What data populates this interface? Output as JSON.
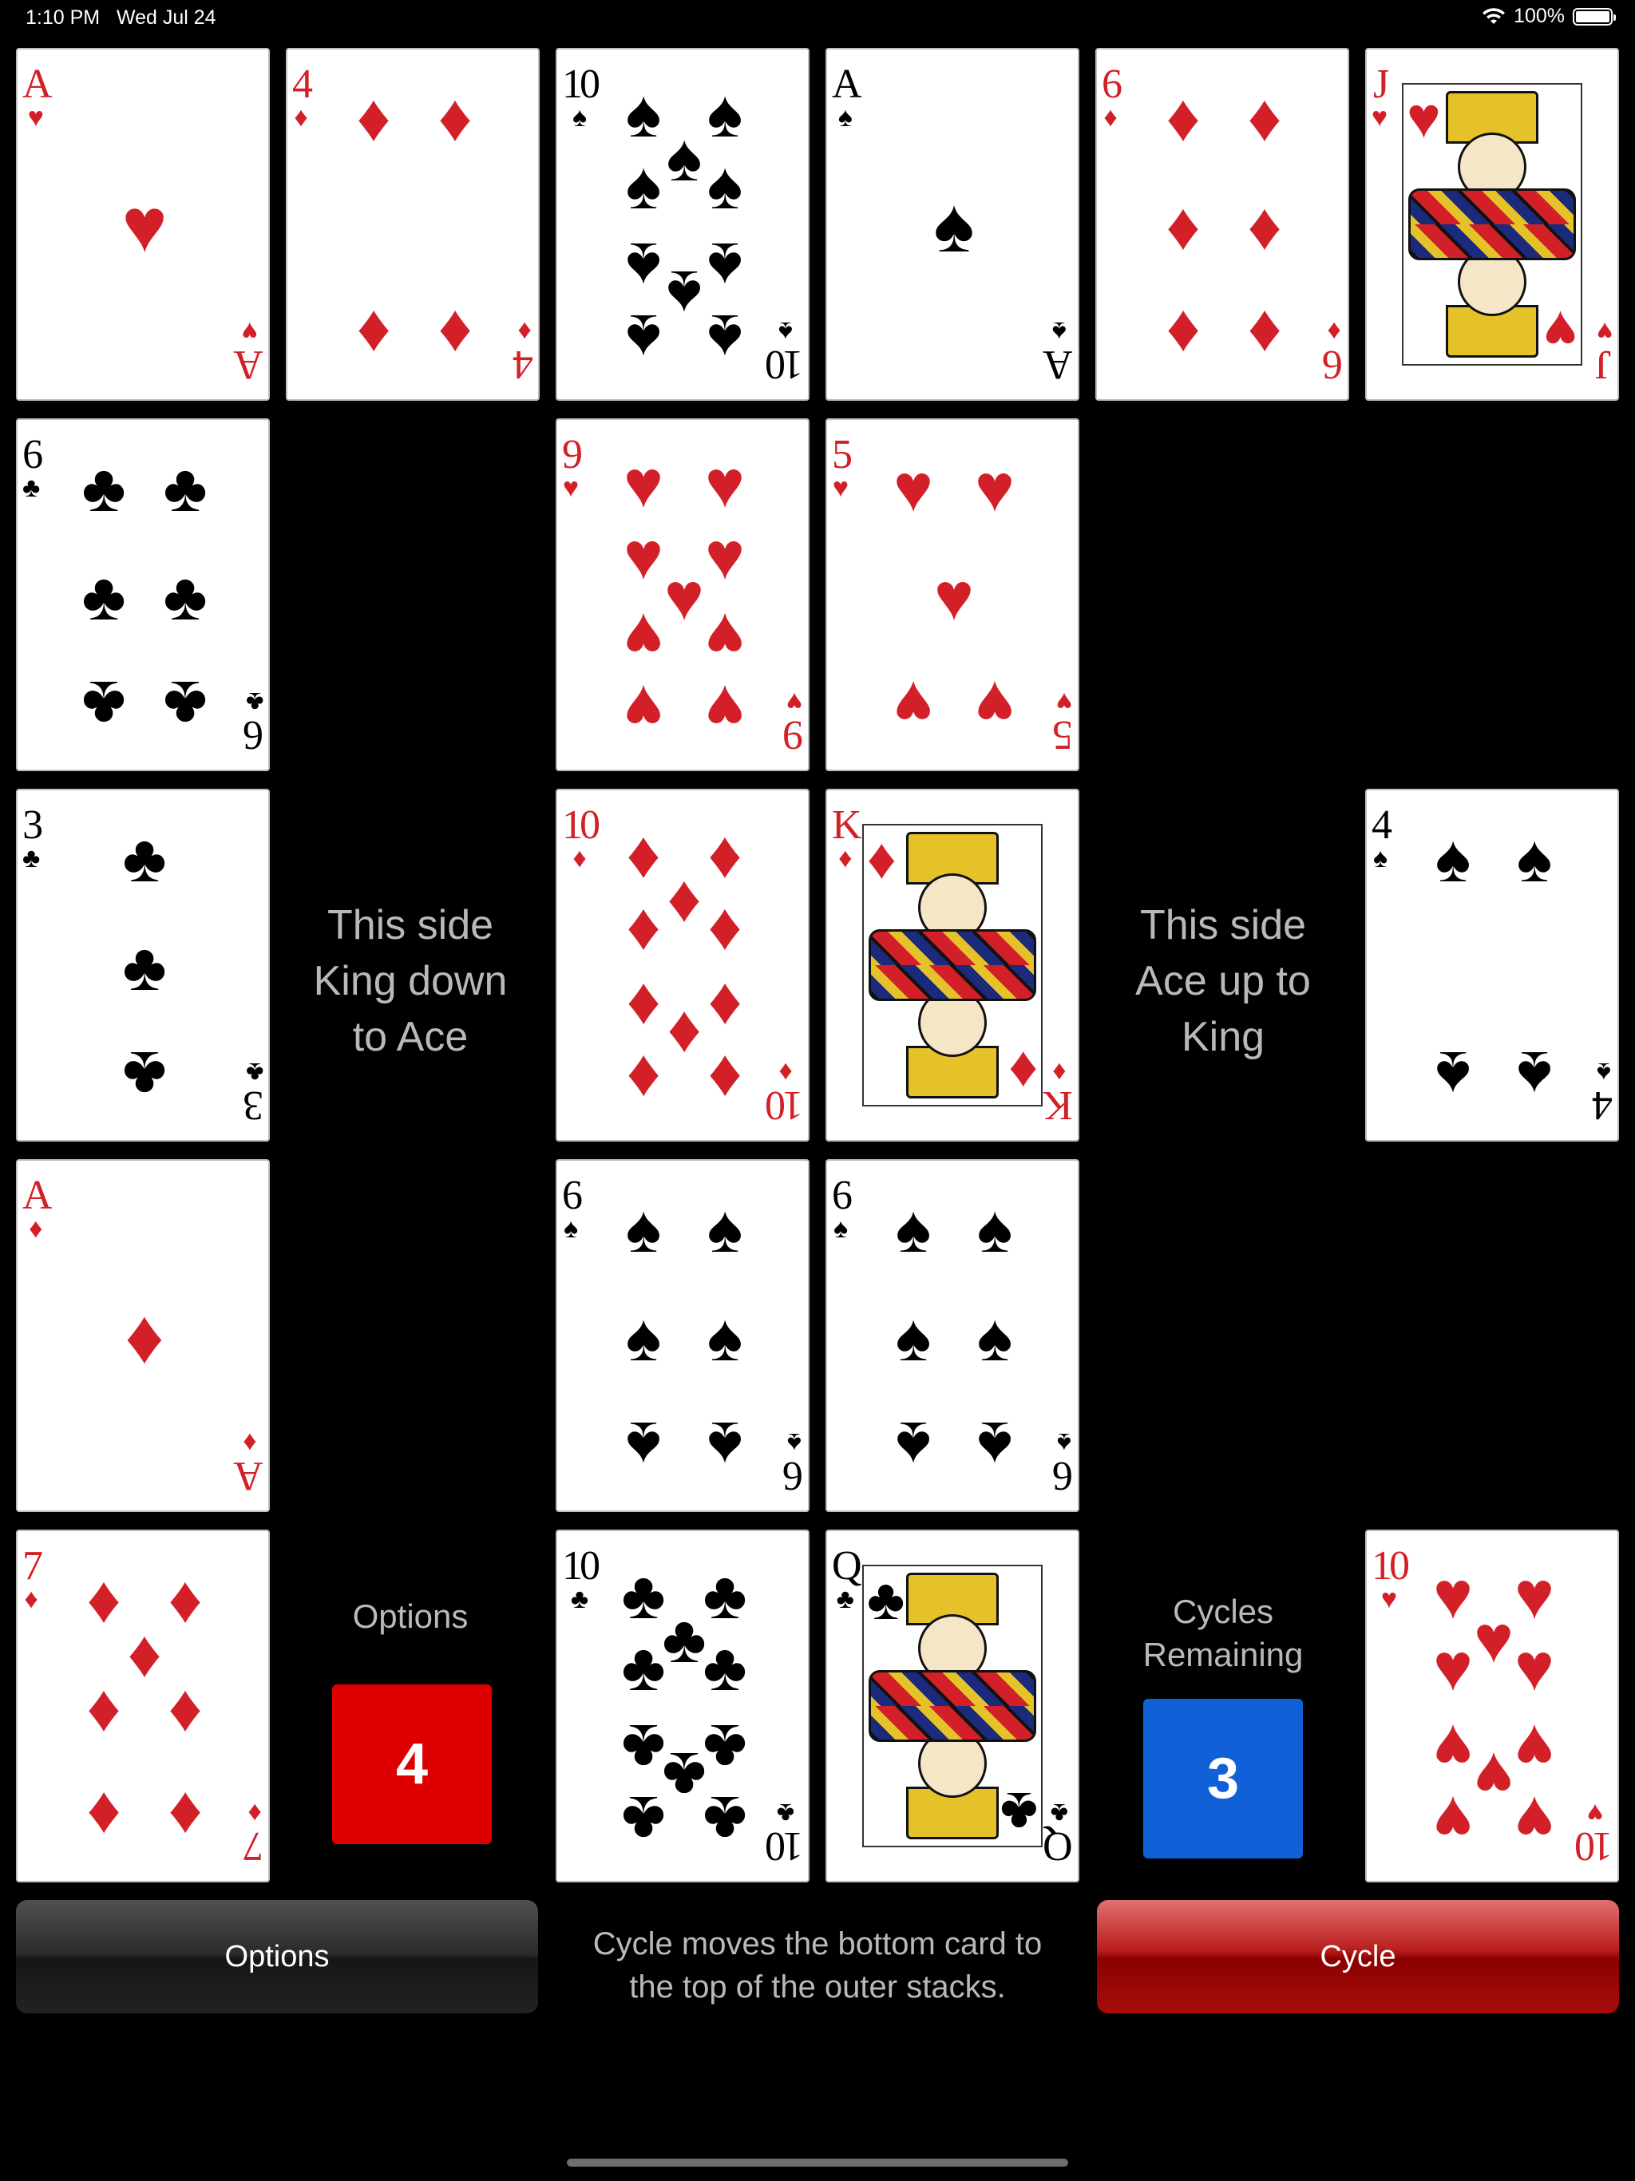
{
  "status_bar": {
    "time": "1:10 PM",
    "date": "Wed Jul 24",
    "battery": "100%",
    "battery_level": 1.0,
    "wifi_icon": "wifi-icon"
  },
  "cards": [
    {
      "rank": "A",
      "suit": "hearts"
    },
    {
      "rank": "4",
      "suit": "diamonds"
    },
    {
      "rank": "10",
      "suit": "spades"
    },
    {
      "rank": "A",
      "suit": "spades"
    },
    {
      "rank": "6",
      "suit": "diamonds"
    },
    {
      "rank": "J",
      "suit": "hearts"
    },
    {
      "rank": "6",
      "suit": "clubs"
    },
    {
      "rank": "9",
      "suit": "hearts"
    },
    {
      "rank": "5",
      "suit": "hearts"
    },
    {
      "rank": "3",
      "suit": "clubs"
    },
    {
      "rank": "10",
      "suit": "diamonds"
    },
    {
      "rank": "K",
      "suit": "diamonds"
    },
    {
      "rank": "4",
      "suit": "spades"
    },
    {
      "rank": "A",
      "suit": "diamonds"
    },
    {
      "rank": "6",
      "suit": "spades"
    },
    {
      "rank": "6",
      "suit": "spades"
    },
    {
      "rank": "7",
      "suit": "diamonds"
    },
    {
      "rank": "10",
      "suit": "clubs"
    },
    {
      "rank": "Q",
      "suit": "clubs"
    },
    {
      "rank": "10",
      "suit": "hearts"
    }
  ],
  "hints": {
    "left": [
      "This side",
      "King down",
      "to Ace"
    ],
    "right": [
      "This side",
      "Ace up to",
      "King"
    ]
  },
  "options_panel": {
    "label": "Options",
    "count": "4",
    "color": "#de0000"
  },
  "cycles_panel": {
    "label_line1": "Cycles",
    "label_line2": "Remaining",
    "count": "3",
    "color": "#1060d8"
  },
  "buttons": {
    "options": "Options",
    "cycle": "Cycle"
  },
  "caption": {
    "line1": "Cycle moves the bottom card to",
    "line2": "the top of the outer stacks."
  }
}
